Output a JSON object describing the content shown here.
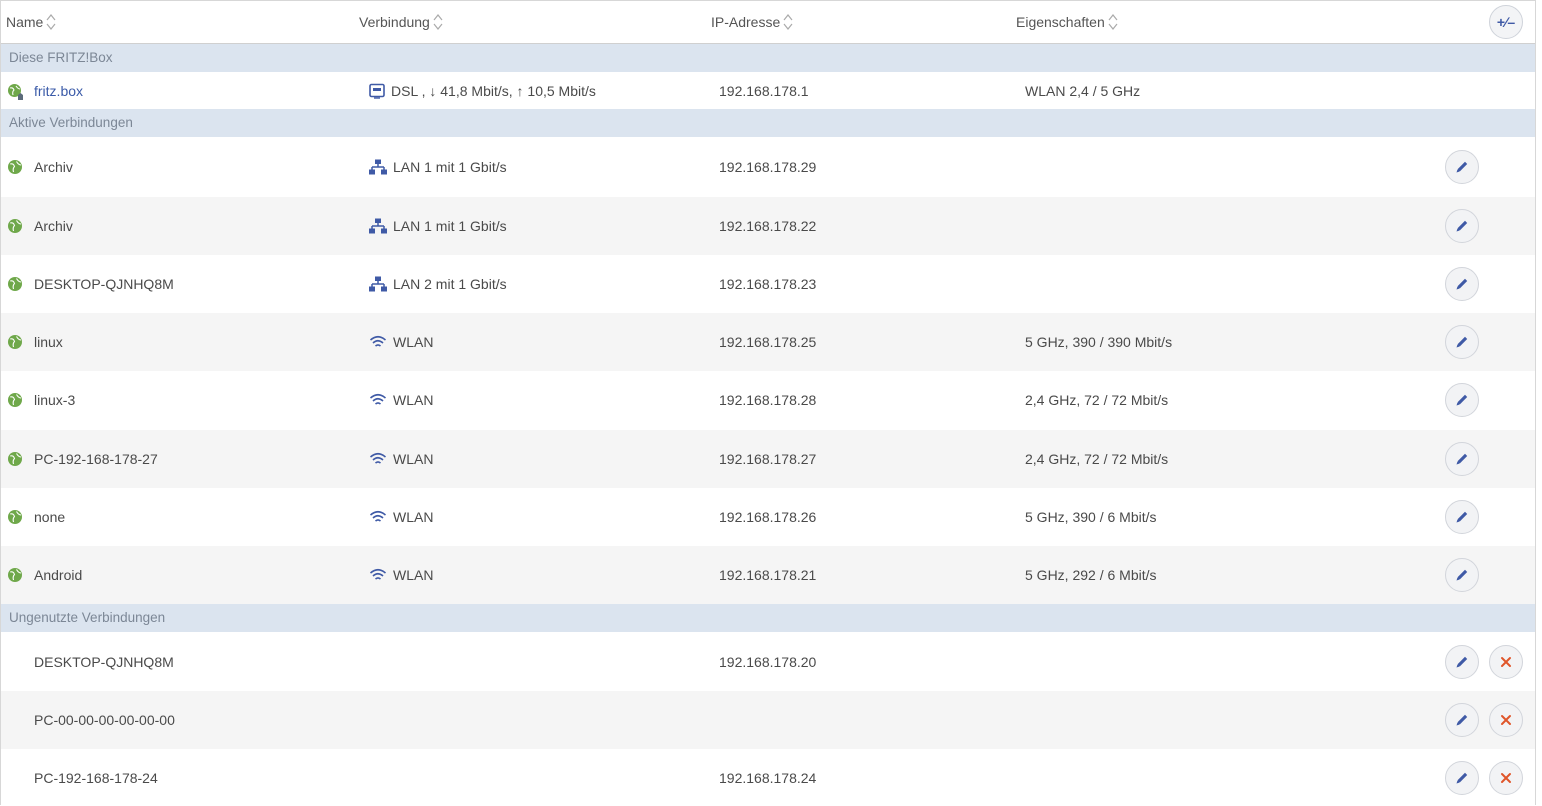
{
  "header": {
    "name": "Name",
    "connection": "Verbindung",
    "ip": "IP-Adresse",
    "properties": "Eigenschaften",
    "add_icon": "plus-minus-icon",
    "add_glyph": "+∕–"
  },
  "groups": {
    "this_box": "Diese FRITZ!Box",
    "active": "Aktive Verbindungen",
    "unused": "Ungenutzte Verbindungen"
  },
  "fritzbox": {
    "name": "fritz.box",
    "connection": "DSL , ↓ 41,8 Mbit/s, ↑ 10,5 Mbit/s",
    "ip": "192.168.178.1",
    "properties": "WLAN 2,4 / 5 GHz"
  },
  "active": [
    {
      "name": "Archiv",
      "connection": "LAN 1 mit 1 Gbit/s",
      "type": "lan",
      "ip": "192.168.178.29",
      "properties": ""
    },
    {
      "name": "Archiv",
      "connection": "LAN 1 mit 1 Gbit/s",
      "type": "lan",
      "ip": "192.168.178.22",
      "properties": ""
    },
    {
      "name": "DESKTOP-QJNHQ8M",
      "connection": "LAN 2 mit 1 Gbit/s",
      "type": "lan",
      "ip": "192.168.178.23",
      "properties": ""
    },
    {
      "name": "linux",
      "connection": "WLAN",
      "type": "wlan",
      "ip": "192.168.178.25",
      "properties": "5 GHz, 390 / 390 Mbit/s"
    },
    {
      "name": "linux-3",
      "connection": "WLAN",
      "type": "wlan",
      "ip": "192.168.178.28",
      "properties": "2,4 GHz, 72 / 72 Mbit/s"
    },
    {
      "name": "PC-192-168-178-27",
      "connection": "WLAN",
      "type": "wlan",
      "ip": "192.168.178.27",
      "properties": "2,4 GHz, 72 / 72 Mbit/s"
    },
    {
      "name": "none",
      "connection": "WLAN",
      "type": "wlan",
      "ip": "192.168.178.26",
      "properties": "5 GHz, 390 / 6 Mbit/s"
    },
    {
      "name": "Android",
      "connection": "WLAN",
      "type": "wlan",
      "ip": "192.168.178.21",
      "properties": "5 GHz, 292 / 6 Mbit/s"
    }
  ],
  "unused": [
    {
      "name": "DESKTOP-QJNHQ8M",
      "ip": "192.168.178.20"
    },
    {
      "name": "PC-00-00-00-00-00-00",
      "ip": ""
    },
    {
      "name": "PC-192-168-178-24",
      "ip": "192.168.178.24"
    }
  ],
  "colors": {
    "accent": "#3f5aa6",
    "group_bg": "#dbe4ef",
    "globe_green": "#6fa84a",
    "delete_red": "#e0562b"
  }
}
